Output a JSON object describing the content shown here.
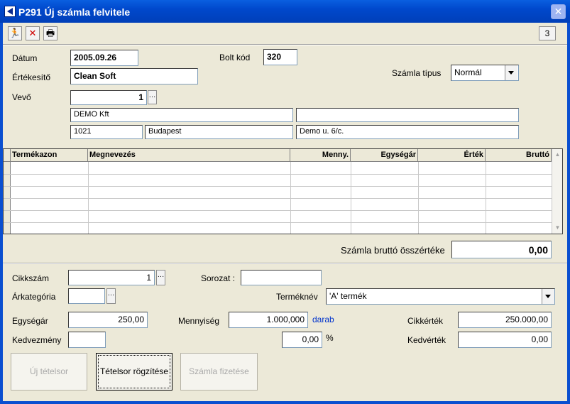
{
  "window": {
    "title": "P291 Új számla felvitele"
  },
  "toolbar": {
    "page_number": "3"
  },
  "header": {
    "date_label": "Dátum",
    "date_value": "2005.09.26",
    "shop_code_label": "Bolt kód",
    "shop_code_value": "320",
    "seller_label": "Értékesítő",
    "seller_value": "Clean Soft",
    "invoice_type_label": "Számla típus",
    "invoice_type_value": "Normál",
    "buyer_label": "Vevő",
    "buyer_code": "1",
    "buyer_name": "DEMO Kft",
    "buyer_name2": "",
    "buyer_zip": "1021",
    "buyer_city": "Budapest",
    "buyer_street": "Demo u. 6/c."
  },
  "grid": {
    "columns": [
      "Termékazon",
      "Megnevezés",
      "Menny.",
      "Egységár",
      "Érték",
      "Bruttó"
    ]
  },
  "totals": {
    "gross_total_label": "Számla bruttó összértéke",
    "gross_total_value": "0,00"
  },
  "item": {
    "article_no_label": "Cikkszám",
    "article_no_value": "1",
    "series_label": "Sorozat :",
    "series_value": "",
    "price_category_label": "Árkategória",
    "price_category_value": "",
    "product_name_label": "Terméknév",
    "product_name_value": "'A' termék",
    "unit_price_label": "Egységár",
    "unit_price_value": "250,00",
    "quantity_label": "Mennyiség",
    "quantity_value": "1.000,000",
    "quantity_unit": "darab",
    "item_value_label": "Cikkérték",
    "item_value_value": "250.000,00",
    "discount_label": "Kedvezmény",
    "discount_value": "",
    "discount_percent_value": "0,00",
    "percent_sign": "%",
    "discount_value_label": "Kedvérték",
    "discount_value_value": "0,00"
  },
  "actions": {
    "new_line": "Új tételsor",
    "save_line": "Tételsor rögzítése",
    "pay_invoice": "Számla fizetése"
  }
}
